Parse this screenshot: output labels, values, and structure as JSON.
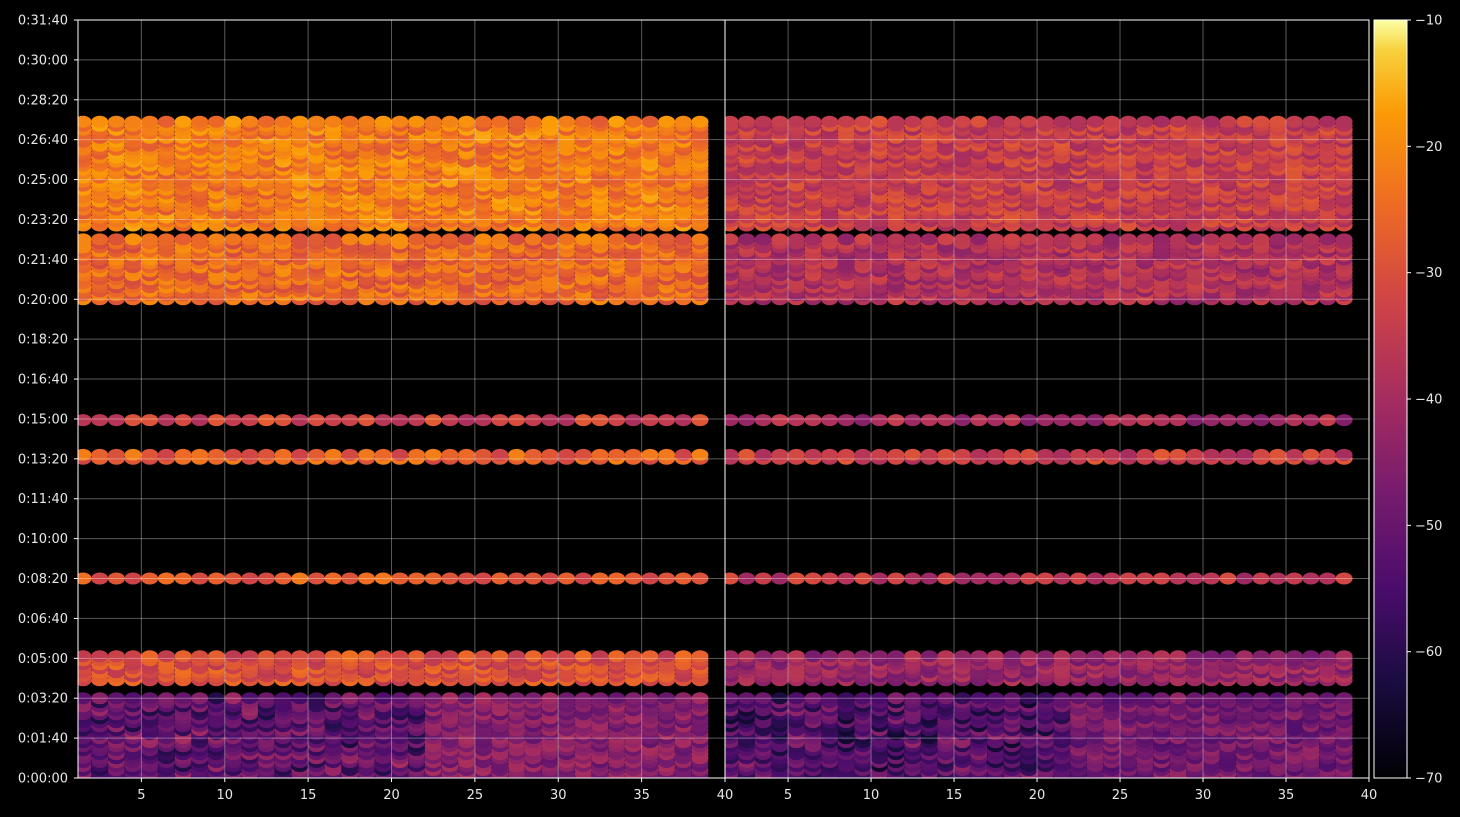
{
  "chart_data": {
    "type": "heatmap",
    "colormap": "inferno",
    "background": "#000000",
    "grid": true,
    "panels": [
      {
        "name": "left",
        "xlim": [
          1.2,
          40
        ],
        "ylim": [
          0,
          1900
        ],
        "x_ticks": [
          5,
          10,
          15,
          20,
          25,
          30,
          35,
          40
        ],
        "x_tick_labels": [
          "5",
          "10",
          "15",
          "20",
          "25",
          "30",
          "35",
          "40"
        ],
        "y_ticks": [
          0,
          100,
          200,
          300,
          400,
          500,
          600,
          700,
          800,
          900,
          1000,
          1100,
          1200,
          1300,
          1400,
          1500,
          1600,
          1700,
          1800,
          1900
        ],
        "y_tick_labels": [
          "0:00:00",
          "0:01:40",
          "0:03:20",
          "0:05:00",
          "0:06:40",
          "0:08:20",
          "0:10:00",
          "0:11:40",
          "0:13:20",
          "0:15:00",
          "0:16:40",
          "0:18:20",
          "0:20:00",
          "0:21:40",
          "0:23:20",
          "0:25:00",
          "0:26:40",
          "0:28:20",
          "0:30:00",
          "0:31:40"
        ]
      },
      {
        "name": "right",
        "xlim": [
          1.2,
          40
        ],
        "ylim": [
          0,
          1900
        ],
        "x_ticks": [
          5,
          10,
          15,
          20,
          25,
          30,
          35,
          40
        ],
        "x_tick_labels": [
          "5",
          "10",
          "15",
          "20",
          "25",
          "30",
          "35",
          "40"
        ]
      }
    ],
    "bands": [
      {
        "y_range": [
          1385,
          1650
        ],
        "left_level": -22,
        "right_level": -34,
        "time_label": "0:23:20–0:27:30"
      },
      {
        "y_range": [
          1200,
          1350
        ],
        "left_level": -25,
        "right_level": -38,
        "time_label": "0:20:00–0:22:30"
      },
      {
        "y_range": [
          897,
          897
        ],
        "left_level": -33,
        "right_level": -40,
        "time_label": "0:14:57"
      },
      {
        "y_range": [
          800,
          815
        ],
        "left_level": -27,
        "right_level": -34,
        "time_label": "0:13:20"
      },
      {
        "y_range": [
          500,
          500
        ],
        "left_level": -27,
        "right_level": -36,
        "time_label": "0:08:20"
      },
      {
        "y_range": [
          245,
          305
        ],
        "left_level": -30,
        "right_level": -42,
        "time_label": "0:04:05–0:05:05"
      },
      {
        "y_range": [
          0,
          200
        ],
        "left_level": -45,
        "right_level": -48,
        "time_label": "0:00:00–0:03:20"
      }
    ],
    "colorbar": {
      "range": [
        -70,
        -10
      ],
      "ticks": [
        -10,
        -20,
        -30,
        -40,
        -50,
        -60,
        -70
      ],
      "tick_labels": [
        "−10",
        "−20",
        "−30",
        "−40",
        "−50",
        "−60",
        "−70"
      ]
    }
  }
}
